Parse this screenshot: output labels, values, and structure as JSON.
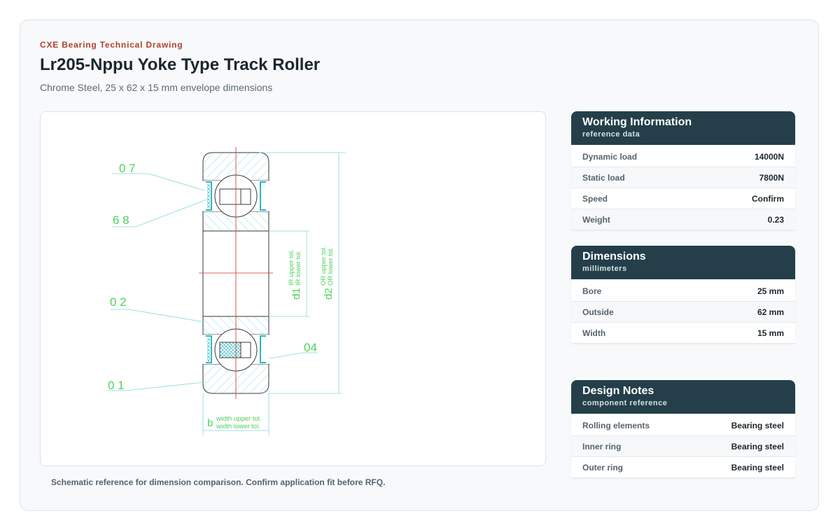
{
  "header": {
    "eyebrow": "CXE Bearing Technical Drawing",
    "title": "Lr205-Nppu Yoke Type Track Roller",
    "subtitle": "Chrome Steel, 25 x 62 x 15 mm envelope dimensions"
  },
  "drawing": {
    "callouts": [
      "0 7",
      "6 8",
      "0 2",
      "0 1",
      "04"
    ],
    "d1_label": "d1",
    "d1_tol_upper": "IR upper tol.",
    "d1_tol_lower": "IR lower tol.",
    "d2_label": "d2",
    "d2_tol_upper": "OR upper tol.",
    "d2_tol_lower": "OR lower tol.",
    "b_label": "b",
    "b_tol_upper": "width upper tol.",
    "b_tol_lower": "width lower tol.",
    "colors": {
      "outline": "#3a3a3a",
      "hatch": "#7fd8dd",
      "leader": "#7fd8dd",
      "label": "#4cd15a",
      "centerline": "#d03030",
      "seal": "#2cb8c2"
    }
  },
  "caption": "Schematic reference for dimension comparison. Confirm application fit before RFQ.",
  "panels": [
    {
      "title": "Working Information",
      "subtitle": "reference data",
      "rows": [
        {
          "label": "Dynamic load",
          "value": "14000N"
        },
        {
          "label": "Static load",
          "value": "7800N"
        },
        {
          "label": "Speed",
          "value": "Confirm"
        },
        {
          "label": "Weight",
          "value": "0.23"
        }
      ]
    },
    {
      "title": "Dimensions",
      "subtitle": "millimeters",
      "rows": [
        {
          "label": "Bore",
          "value": "25 mm"
        },
        {
          "label": "Outside",
          "value": "62 mm"
        },
        {
          "label": "Width",
          "value": "15 mm"
        }
      ]
    },
    {
      "title": "Design Notes",
      "subtitle": "component reference",
      "rows": [
        {
          "label": "Rolling elements",
          "value": "Bearing steel"
        },
        {
          "label": "Inner ring",
          "value": "Bearing steel"
        },
        {
          "label": "Outer ring",
          "value": "Bearing steel"
        }
      ]
    }
  ],
  "theme": {
    "accent": "#b0402e",
    "panel_header": "#243f4a"
  }
}
